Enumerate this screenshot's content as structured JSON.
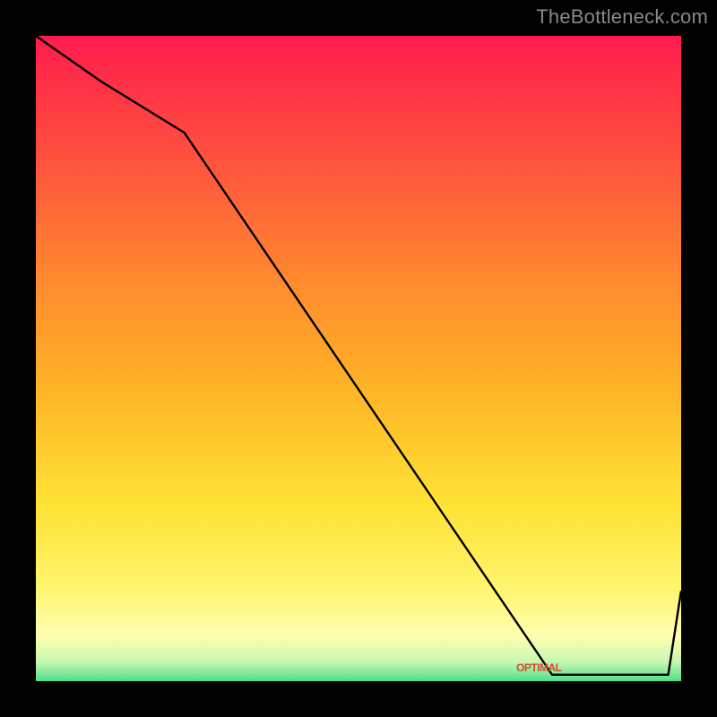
{
  "attribution": "TheBottleneck.com",
  "chart_data": {
    "type": "line",
    "title": "",
    "xlabel": "",
    "ylabel": "",
    "xlim": [
      0,
      100
    ],
    "ylim": [
      0,
      100
    ],
    "series": [
      {
        "name": "bottleneck-curve",
        "x": [
          0,
          10,
          23,
          80,
          98,
          100
        ],
        "y": [
          100,
          93,
          85,
          1,
          1,
          14
        ]
      }
    ],
    "annotations": [
      {
        "name": "optimal-label",
        "text": "OPTIMAL",
        "x": 80,
        "y": 1.5
      }
    ],
    "background_gradient": {
      "direction": "vertical",
      "stops": [
        {
          "pos": 0.0,
          "color": "#ff1a4f"
        },
        {
          "pos": 0.07,
          "color": "#ff3047"
        },
        {
          "pos": 0.22,
          "color": "#ff5a3c"
        },
        {
          "pos": 0.38,
          "color": "#ff8a2e"
        },
        {
          "pos": 0.55,
          "color": "#ffb527"
        },
        {
          "pos": 0.73,
          "color": "#ffe335"
        },
        {
          "pos": 0.85,
          "color": "#fff46b"
        },
        {
          "pos": 0.93,
          "color": "#ffffb0"
        },
        {
          "pos": 0.97,
          "color": "#c9f7b3"
        },
        {
          "pos": 1.0,
          "color": "#4de08a"
        }
      ]
    }
  }
}
